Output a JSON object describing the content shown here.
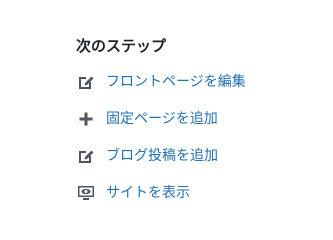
{
  "next_steps": {
    "title": "次のステップ",
    "items": [
      {
        "label": "フロントページを編集",
        "icon": "edit-icon"
      },
      {
        "label": "固定ページを追加",
        "icon": "plus-icon"
      },
      {
        "label": "ブログ投稿を追加",
        "icon": "edit-icon"
      },
      {
        "label": "サイトを表示",
        "icon": "view-site-icon"
      }
    ]
  },
  "colors": {
    "heading": "#1d2327",
    "link": "#2271b1",
    "icon": "#50575e"
  }
}
